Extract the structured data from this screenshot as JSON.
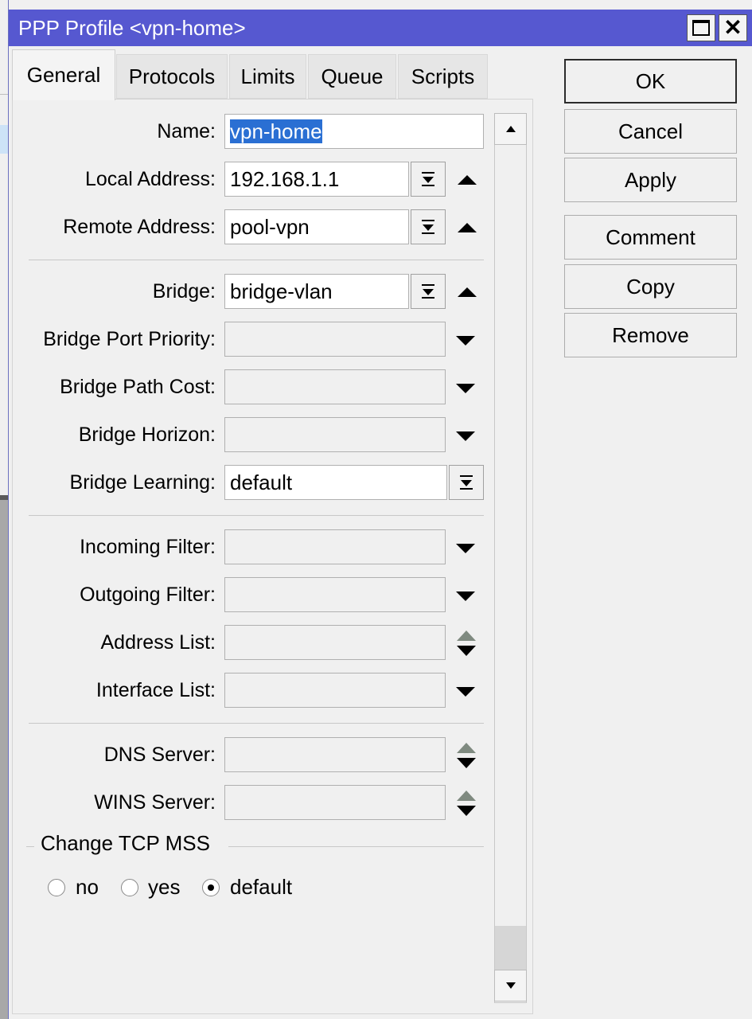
{
  "window": {
    "title": "PPP Profile <vpn-home>"
  },
  "tabs": [
    "General",
    "Protocols",
    "Limits",
    "Queue",
    "Scripts"
  ],
  "fields": {
    "name": {
      "label": "Name:",
      "value": "vpn-home"
    },
    "local_address": {
      "label": "Local Address:",
      "value": "192.168.1.1"
    },
    "remote_address": {
      "label": "Remote Address:",
      "value": "pool-vpn"
    },
    "bridge": {
      "label": "Bridge:",
      "value": "bridge-vlan"
    },
    "bridge_port_priority": {
      "label": "Bridge Port Priority:",
      "value": ""
    },
    "bridge_path_cost": {
      "label": "Bridge Path Cost:",
      "value": ""
    },
    "bridge_horizon": {
      "label": "Bridge Horizon:",
      "value": ""
    },
    "bridge_learning": {
      "label": "Bridge Learning:",
      "value": "default"
    },
    "incoming_filter": {
      "label": "Incoming Filter:",
      "value": ""
    },
    "outgoing_filter": {
      "label": "Outgoing Filter:",
      "value": ""
    },
    "address_list": {
      "label": "Address List:",
      "value": ""
    },
    "interface_list": {
      "label": "Interface List:",
      "value": ""
    },
    "dns_server": {
      "label": "DNS Server:",
      "value": ""
    },
    "wins_server": {
      "label": "WINS Server:",
      "value": ""
    }
  },
  "change_tcp_mss": {
    "label": "Change TCP MSS",
    "options": [
      "no",
      "yes",
      "default"
    ],
    "selected": "default"
  },
  "buttons": {
    "ok": "OK",
    "cancel": "Cancel",
    "apply": "Apply",
    "comment": "Comment",
    "copy": "Copy",
    "remove": "Remove"
  },
  "colors": {
    "titlebar": "#5658d0",
    "selection": "#2a6fd3"
  }
}
